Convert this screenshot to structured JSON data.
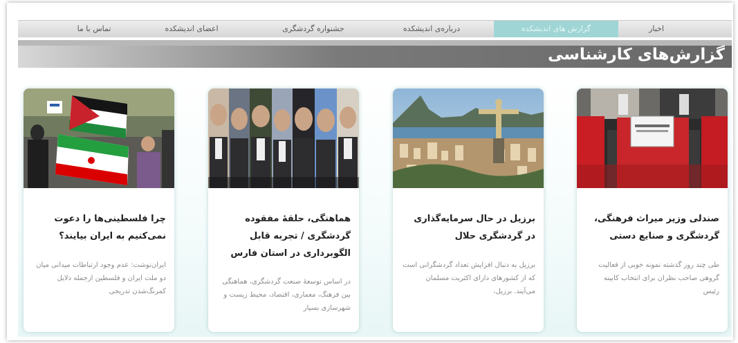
{
  "nav": {
    "items": [
      {
        "label": "اخبار"
      },
      {
        "label": "گزارش های اندیشکده"
      },
      {
        "label": "درباره‌ی اندیشکده"
      },
      {
        "label": "جشنواره گردشگری"
      },
      {
        "label": "اعضای اندیشکده"
      },
      {
        "label": "تماس با ما"
      }
    ],
    "active_index": 1
  },
  "section": {
    "title": "گزارش‌های کارشناسی"
  },
  "cards": [
    {
      "image": "meeting-red-chairs",
      "sign_text": "جای وزیر میراث فرهنگی، گردشگری و صنایع دستی",
      "title": "صندلی وزیر میراث فرهنگی، گردشگری و صنایع دستی",
      "excerpt": "طی چند روز گذشته نمونه خوبی از فعالیت گروهی صاحب نظران برای انتخاب کابینه رئیس"
    },
    {
      "image": "rio-christ-redeemer",
      "title": "برزیل در حال سرمایه‌گذاری در گردشگری حلال",
      "excerpt": "برزیل به دنبال افزایش تعداد گردشگرانی است که از کشورهای دارای اکثریت مسلمان می‌آیند. برزیل،"
    },
    {
      "image": "officials-portraits",
      "title": "هماهنگی، حلقهٔ مفقوده گردشگری / تجربه قابل الگوبرداری در استان فارس",
      "excerpt": "در اساس توسعهٔ صنعت گردشگری، هماهنگی بین فرهنگ، معماری، اقتصاد، محیط زیست و شهرسازی بسیار"
    },
    {
      "image": "palestine-iran-flags",
      "title": "چرا فلسطینی‌ها را دعوت نمی‌کنیم به ایران بیایند؟",
      "excerpt": "ایران‌نوشت: عدم وجود ارتباطات میدانی میان دو ملت ایران و فلسطین ازجمله دلایل کمرنگ‌شدن تدریجی"
    }
  ],
  "colors": {
    "nav_active": "#9fd5d5",
    "band_dark": "#686868",
    "card_shadow": "#78aaaa"
  }
}
